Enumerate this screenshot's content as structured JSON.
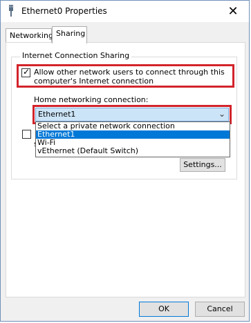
{
  "window": {
    "title": "Ethernet0 Properties",
    "close_glyph": "✕"
  },
  "tabs": [
    {
      "label": "Networking",
      "selected": false
    },
    {
      "label": "Sharing",
      "selected": true
    }
  ],
  "ics": {
    "group_label": "Internet Connection Sharing",
    "allow_checkbox": {
      "checked": true,
      "label": "Allow other network users to connect through this computer's Internet connection"
    },
    "home_label": "Home networking connection:",
    "select": {
      "value": "Ethernet1",
      "options": [
        "Select a private network connection",
        "Ethernet1",
        "Wi-Fi",
        "vEthernet (Default Switch)"
      ],
      "highlighted_index": 1
    },
    "second_checkbox": {
      "checked": false,
      "label_visible": "s"
    },
    "settings_button": "Settings..."
  },
  "footer": {
    "ok": "OK",
    "cancel": "Cancel"
  },
  "colors": {
    "highlight_border": "#d2232a",
    "selection": "#0078d7"
  }
}
